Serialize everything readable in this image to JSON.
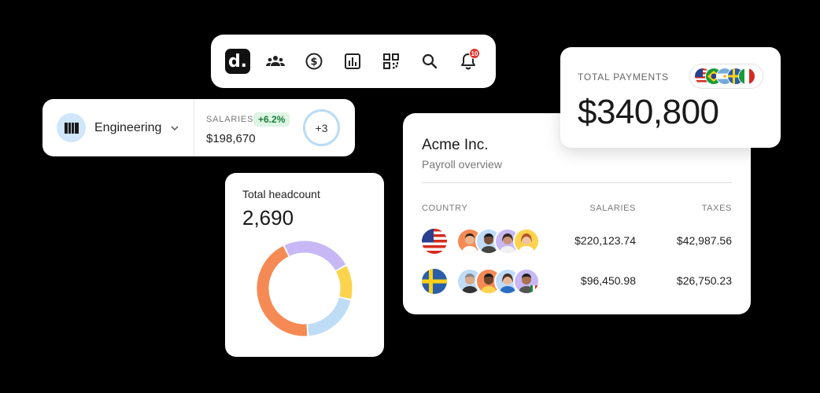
{
  "toolbar": {
    "logo": "d.",
    "icons": [
      "people-icon",
      "dollar-icon",
      "chart-icon",
      "qr-code-icon",
      "search-icon",
      "bell-icon"
    ],
    "notification_count": "10"
  },
  "department": {
    "name": "Engineering",
    "salaries_label": "SALARIES",
    "change": "+6.2%",
    "salaries_value": "$198,670",
    "more": "+3"
  },
  "headcount": {
    "label": "Total headcount",
    "value": "2,690",
    "segments": [
      {
        "color": "#c7b8f5",
        "fraction": 0.24
      },
      {
        "color": "#fcd34d",
        "fraction": 0.12
      },
      {
        "color": "#bfdcf7",
        "fraction": 0.2
      },
      {
        "color": "#f58a55",
        "fraction": 0.44
      }
    ]
  },
  "payroll": {
    "company": "Acme Inc.",
    "subtitle": "Payroll overview",
    "columns": {
      "country": "COUNTRY",
      "salaries": "SALARIES",
      "taxes": "TAXES"
    },
    "rows": [
      {
        "country_icon": "us-flag-icon",
        "salaries": "$220,123.74",
        "taxes": "$42,987.56"
      },
      {
        "country_icon": "sweden-flag-icon",
        "salaries": "$96,450.98",
        "taxes": "$26,750.23"
      }
    ]
  },
  "total_payments": {
    "label": "TOTAL PAYMENTS",
    "value": "$340,800"
  }
}
